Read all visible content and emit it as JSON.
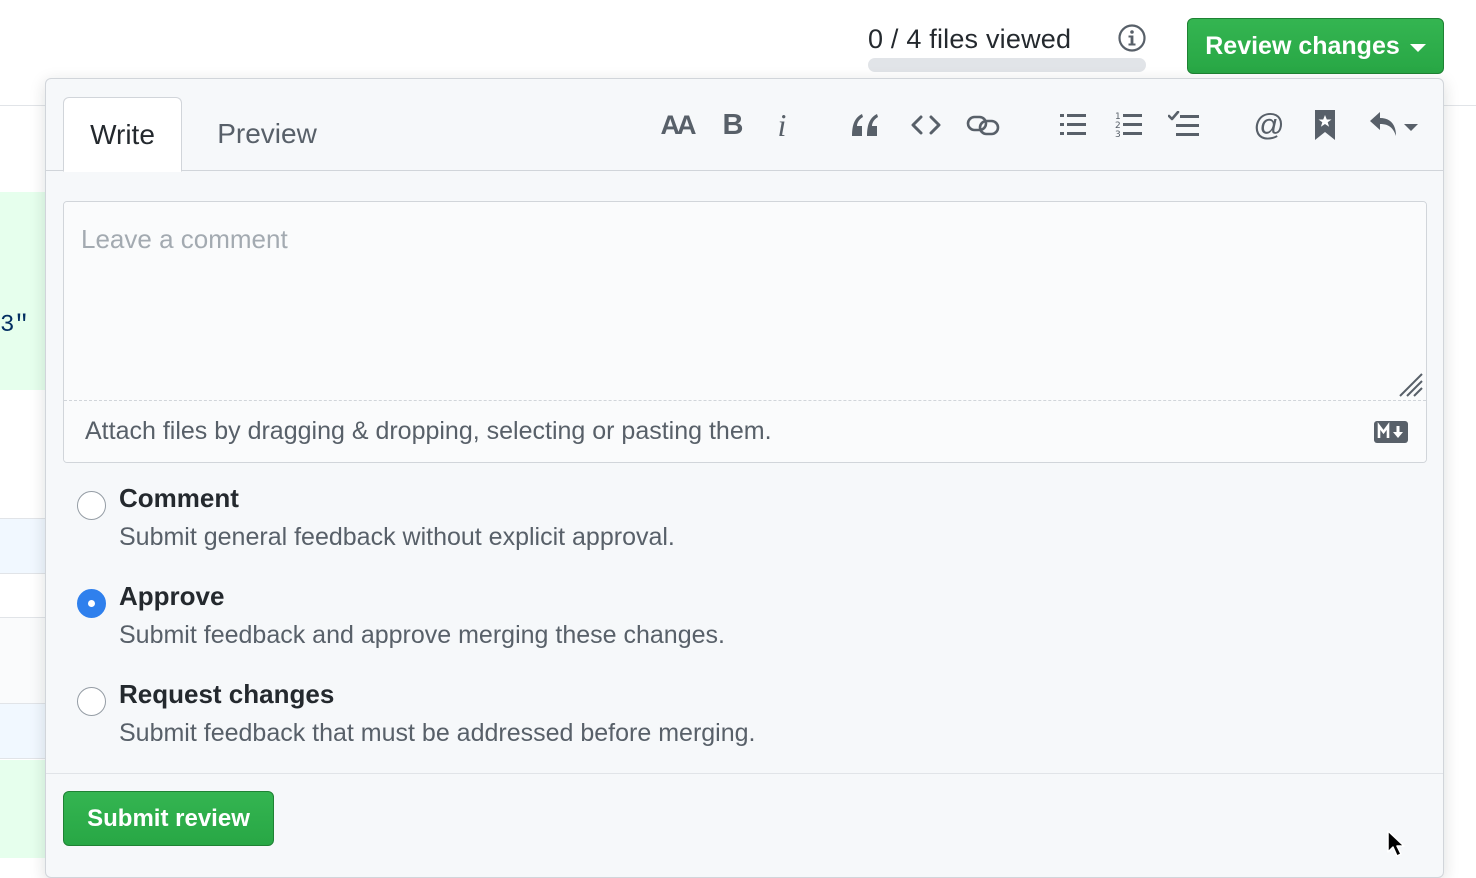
{
  "header": {
    "files_viewed_label": "0 / 4 files viewed",
    "files_viewed_progress": 0,
    "info_icon": "info-icon",
    "review_button_label": "Review changes"
  },
  "background": {
    "code_fragment": "3\""
  },
  "review": {
    "tabs": [
      {
        "label": "Write",
        "active": true
      },
      {
        "label": "Preview",
        "active": false
      }
    ],
    "toolbar": {
      "heading_text": "AA",
      "bold_text": "B",
      "italic_text": "i",
      "mention_text": "@",
      "icons": [
        "text-size-icon",
        "bold-icon",
        "italic-icon",
        "quote-icon",
        "code-icon",
        "link-icon",
        "bulleted-list-icon",
        "numbered-list-icon",
        "task-list-icon",
        "mention-icon",
        "saved-reply-icon",
        "reply-icon"
      ]
    },
    "comment": {
      "value": "",
      "placeholder": "Leave a comment"
    },
    "attach_text": "Attach files by dragging & dropping, selecting or pasting them.",
    "markdown_badge": "markdown-icon",
    "options": [
      {
        "title": "Comment",
        "description": "Submit general feedback without explicit approval.",
        "checked": false
      },
      {
        "title": "Approve",
        "description": "Submit feedback and approve merging these changes.",
        "checked": true
      },
      {
        "title": "Request changes",
        "description": "Submit feedback that must be addressed before merging.",
        "checked": false
      }
    ],
    "submit_label": "Submit review"
  },
  "colors": {
    "primary_green": "#28a745",
    "radio_blue": "#2f80ed",
    "diff_added": "#e6ffed"
  }
}
